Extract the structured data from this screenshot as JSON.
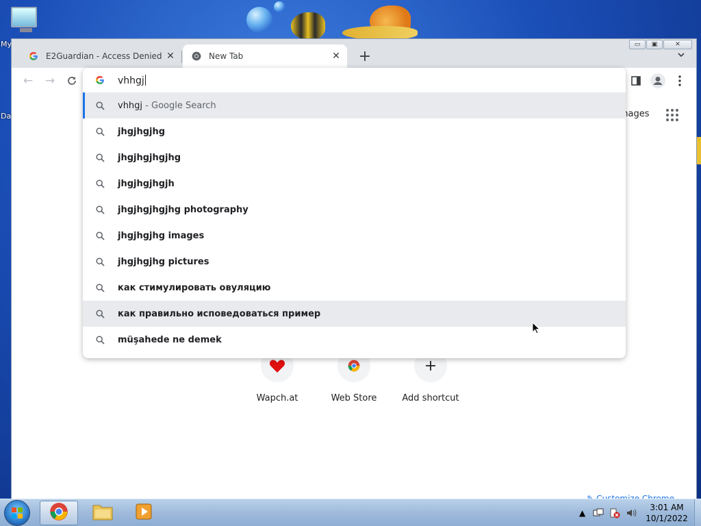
{
  "desktop": {
    "icon_label_1": "My",
    "icon_label_2": "Da"
  },
  "tabs": [
    {
      "title": "E2Guardian - Access Denied",
      "favicon": "google-g-icon"
    },
    {
      "title": "New Tab",
      "favicon": "chrome-icon"
    }
  ],
  "window_controls": {
    "minimize": "▭",
    "restore": "▣",
    "close": "✕"
  },
  "omnibox": {
    "value": "vhhgj",
    "suggestions": [
      {
        "text": "vhhgj",
        "suffix": " - Google Search",
        "highlighted": true,
        "selected": true
      },
      {
        "text": "jhgjhgjhg"
      },
      {
        "text": "jhgjhgjhgjhg"
      },
      {
        "text": "jhgjhgjhgjh"
      },
      {
        "text": "jhgjhgjhgjhg photography"
      },
      {
        "text": "jhgjhgjhg images"
      },
      {
        "text": "jhgjhgjhg pictures"
      },
      {
        "text": "как стимулировать овуляцию"
      },
      {
        "text": "как правильно исповедоваться пример",
        "highlighted": true
      },
      {
        "text": "müşahede ne demek"
      }
    ]
  },
  "newtab": {
    "images_link": "Images",
    "shortcuts": [
      {
        "label": "Wapch.at",
        "icon": "heart-icon"
      },
      {
        "label": "Web Store",
        "icon": "chrome-webstore-icon"
      },
      {
        "label": "Add shortcut",
        "icon": "plus-icon"
      }
    ],
    "customize_label": "Customize Chrome"
  },
  "taskbar": {
    "time": "3:01 AM",
    "date": "10/1/2022"
  },
  "colors": {
    "accent": "#1a73e8",
    "highlight_row": "#e8eaed",
    "tab_bar": "#dee1e6"
  }
}
